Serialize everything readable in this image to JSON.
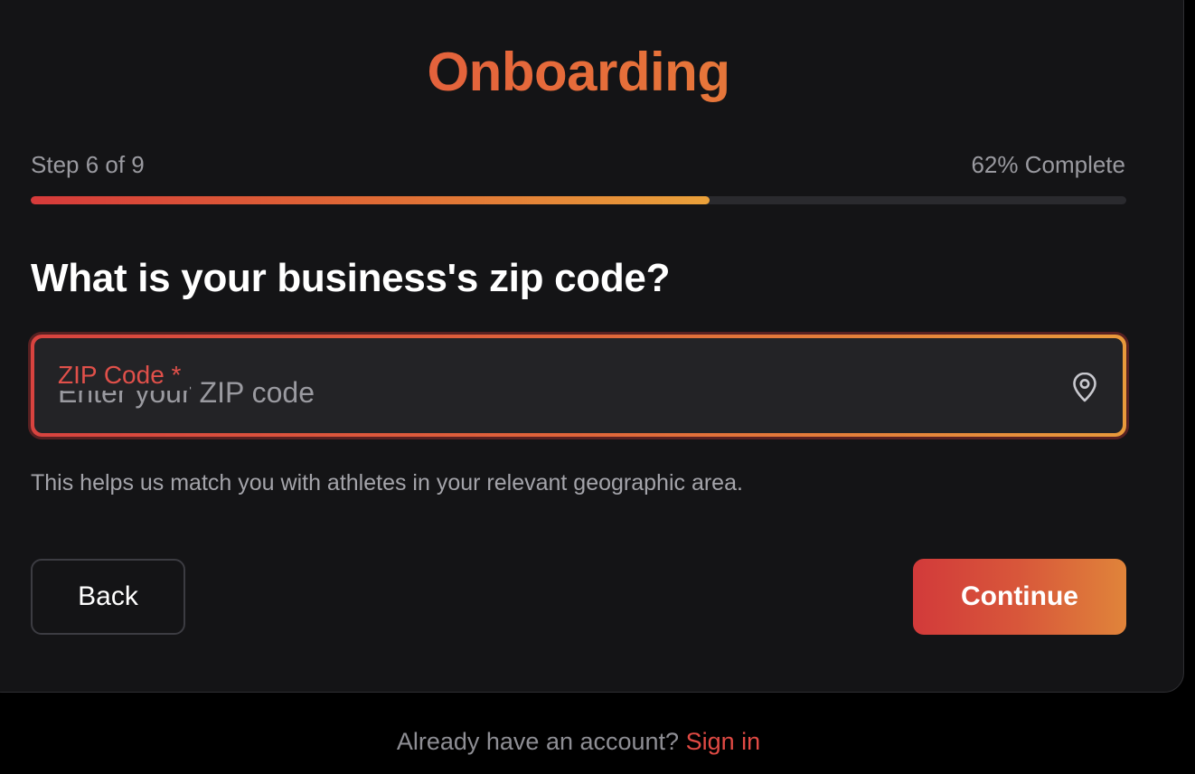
{
  "header": {
    "title": "Onboarding"
  },
  "progress": {
    "step_label": "Step 6 of 9",
    "complete_label": "62% Complete",
    "percent": 62
  },
  "question": {
    "text": "What is your business's zip code?"
  },
  "zip_field": {
    "label": "ZIP Code *",
    "placeholder": "Enter your ZIP code",
    "value": "",
    "icon": "map-pin-icon"
  },
  "helper_text": "This helps us match you with athletes in your relevant geographic area.",
  "actions": {
    "back_label": "Back",
    "continue_label": "Continue"
  },
  "footer": {
    "prompt": "Already have an account?",
    "link_label": "Sign in"
  },
  "colors": {
    "accent_red": "#d63a3a",
    "accent_orange": "#e9963b",
    "card_bg": "#141416",
    "field_bg": "#232326"
  }
}
